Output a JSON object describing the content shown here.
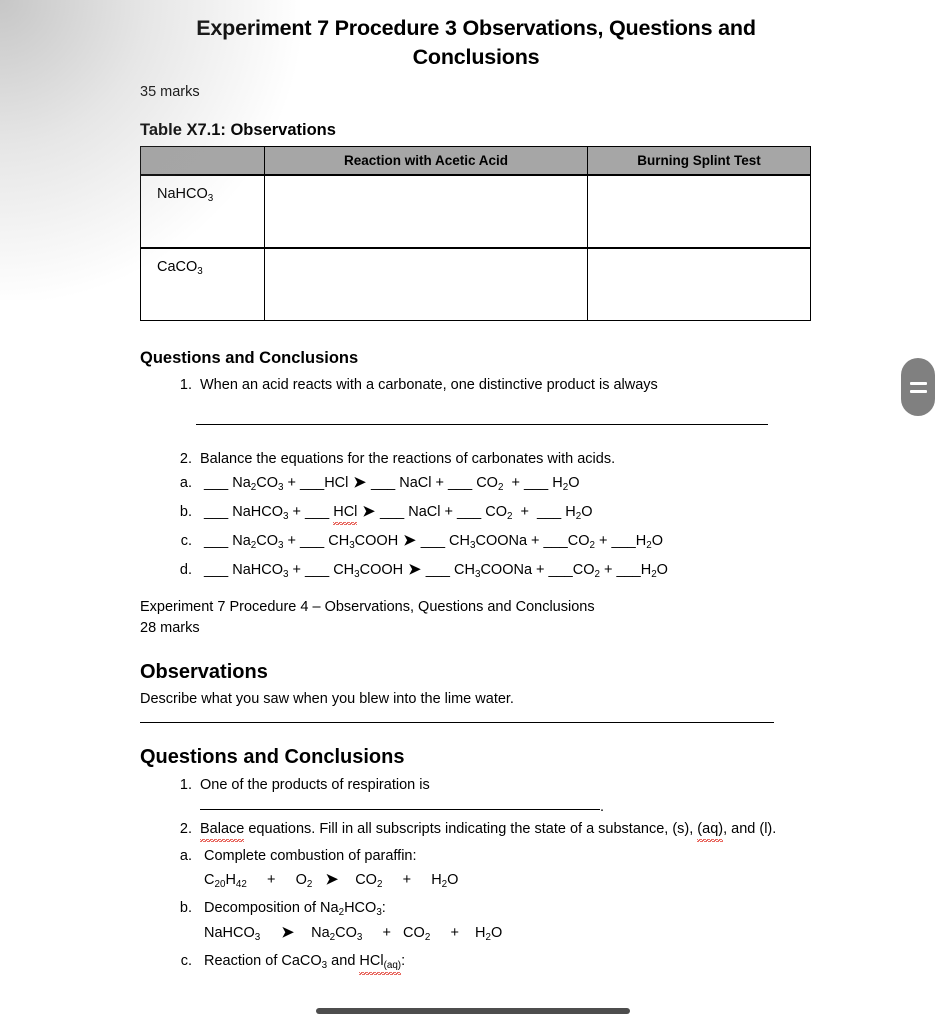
{
  "document": {
    "title": "Experiment 7 Procedure 3 Observations, Questions and Conclusions",
    "marks": "35 marks",
    "table_caption": "Table X7.1: Observations"
  },
  "table": {
    "headers": [
      "",
      "Reaction with Acetic Acid",
      "Burning Splint Test"
    ],
    "rows": [
      {
        "label_main": "NaHCO",
        "label_sub": "3",
        "cells": [
          "",
          ""
        ]
      },
      {
        "label_main": "CaCO",
        "label_sub": "3",
        "cells": [
          "",
          ""
        ]
      }
    ]
  },
  "section_p3": {
    "heading": "Questions and Conclusions",
    "q1": "When an acid reacts with a carbonate, one distinctive product is always",
    "q2": "Balance the equations for the reactions of carbonates with acids.",
    "equations": [
      {
        "id": "a",
        "parts": [
          "___ Na",
          "2",
          "CO",
          "3",
          " + ___HCl ",
          "➔",
          " ___ NaCl + ___ CO",
          "2",
          " + ___ H",
          "2",
          "O"
        ],
        "text": "___ Na2CO3 + ___HCl ➔ ___ NaCl + ___ CO2 + ___ H2O",
        "misspelled": ""
      },
      {
        "id": "b",
        "text": "___ NaHCO3 + ___ HCl ➔ ___ NaCl + ___ CO2 + ___ H2O",
        "misspelled": "HCl"
      },
      {
        "id": "c",
        "text": "___ Na2CO3 + ___ CH3COOH ➔ ___ CH3COONa + ___CO2 + ___H2O",
        "misspelled": ""
      },
      {
        "id": "d",
        "text": "___ NaHCO3 + ___ CH3COOH ➔ ___ CH3COONa + ___CO2 + ___H2O",
        "misspelled": ""
      }
    ]
  },
  "section_p4": {
    "title_line": "Experiment 7 Procedure 4 – Observations, Questions and Conclusions",
    "marks": "28 marks",
    "observations_heading": "Observations",
    "observations_prompt": "Describe what you saw when you blew into the lime water.",
    "questions_heading": "Questions and Conclusions",
    "q1_prefix": "One of the products of respiration is",
    "q1_suffix": ".",
    "q2": "Balace equations. Fill in all subscripts indicating the state of a substance, (s), (aq), and (l).",
    "q2_misspelled": [
      "Balace",
      "(aq)"
    ],
    "items": [
      {
        "id": "a",
        "prompt": "Complete combustion of paraffin:",
        "equation": "C20H42    +    O2    ➔    CO2    +    H2O"
      },
      {
        "id": "b",
        "prompt": "Decomposition of Na2HCO3:",
        "equation": "NaHCO3    ➔    Na2CO3    +    CO2    +    H2O"
      },
      {
        "id": "c",
        "prompt": "Reaction of CaCO3 and HCl(aq):",
        "equation": "",
        "misspelled": "HCl(aq)"
      }
    ]
  },
  "chrome": {
    "drag_handle": "drag-handle",
    "horizontal_scrollbar": "horizontal-scrollbar"
  },
  "colors": {
    "table_header_bg": "#a6a6a6",
    "spellcheck_underline": "#e03a2f",
    "scrollbar": "#4d4d4d",
    "handle": "#808080"
  }
}
